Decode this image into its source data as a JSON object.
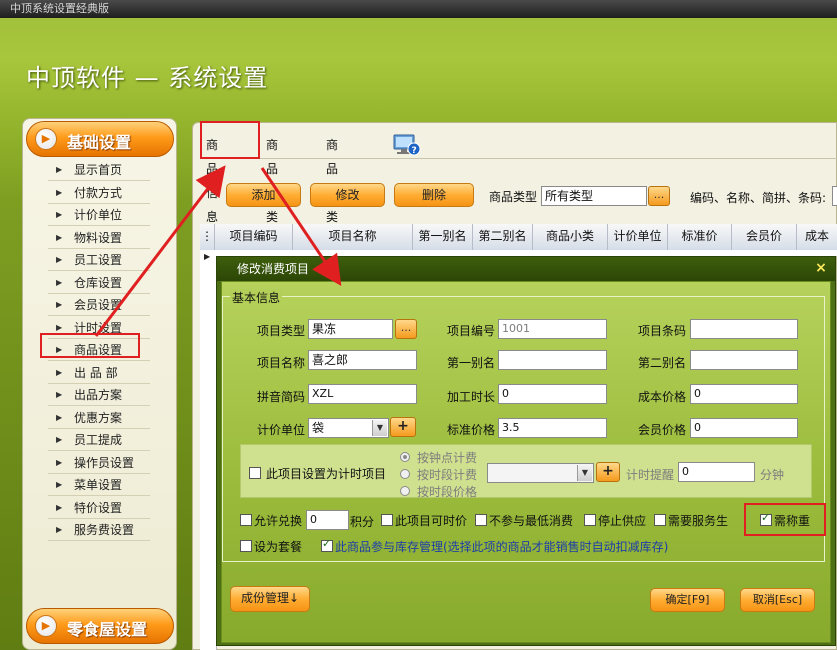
{
  "window": {
    "title": "中顶系统设置经典版"
  },
  "app_title": "中顶软件 — 系统设置",
  "sidebar": {
    "header": "基础设置",
    "footer": "零食屋设置",
    "items": [
      "显示首页",
      "付款方式",
      "计价单位",
      "物料设置",
      "员工设置",
      "仓库设置",
      "会员设置",
      "计时设置",
      "商品设置",
      "出 品 部",
      "出品方案",
      "优惠方案",
      "员工提成",
      "操作员设置",
      "菜单设置",
      "特价设置",
      "服务费设置"
    ],
    "active": "商品设置"
  },
  "tabs": [
    "商品信息",
    "商品大类",
    "商品小类"
  ],
  "toolbar": {
    "add": "添加",
    "edit": "修改",
    "delete": "删除",
    "type_label": "商品类型",
    "type_value": "所有类型",
    "ellipsis": "...",
    "search_label": "编码、名称、简拼、条码:"
  },
  "grid_columns": [
    "项目编码",
    "项目名称",
    "第一别名",
    "第二别名",
    "商品小类",
    "计价单位",
    "标准价",
    "会员价",
    "成本"
  ],
  "dialog": {
    "title": "修改消费项目",
    "close": "×",
    "group": "基本信息",
    "fields": {
      "item_type": {
        "label": "项目类型",
        "value": "果冻"
      },
      "item_no": {
        "label": "项目编号",
        "value": "1001"
      },
      "barcode": {
        "label": "项目条码",
        "value": ""
      },
      "item_name": {
        "label": "项目名称",
        "value": "喜之郎"
      },
      "alias1": {
        "label": "第一别名",
        "value": ""
      },
      "alias2": {
        "label": "第二别名",
        "value": ""
      },
      "pinyin": {
        "label": "拼音简码",
        "value": "XZL"
      },
      "process_time": {
        "label": "加工时长",
        "value": "0"
      },
      "cost_price": {
        "label": "成本价格",
        "value": "0"
      },
      "unit": {
        "label": "计价单位",
        "value": "袋"
      },
      "std_price": {
        "label": "标准价格",
        "value": "3.5"
      },
      "member_price": {
        "label": "会员价格",
        "value": "0"
      }
    },
    "timing": {
      "checkbox_label": "此项目设置为计时项目",
      "radio1": "按钟点计费",
      "radio2": "按时段计费",
      "radio3": "按时段价格",
      "reminder_label": "计时提醒",
      "reminder_value": "0",
      "minutes": "分钟",
      "plus": "+"
    },
    "options": {
      "allow_exchange": "允许兑换",
      "exchange_value": "0",
      "points": "积分",
      "time_price": "此项目可时价",
      "no_min": "不参与最低消费",
      "stop_supply": "停止供应",
      "need_service": "需要服务生",
      "need_weigh": "需称重",
      "set_meal": "设为套餐",
      "inventory": "此商品参与库存管理(选择此项的商品才能销售时自动扣减库存)"
    },
    "buttons": {
      "component": "成份管理↓",
      "ok": "确定[F9]",
      "cancel": "取消[Esc]"
    }
  },
  "colors": {
    "accent_orange": "#ff9a1a",
    "highlight_red": "#e02020",
    "dialog_green": "#4d7015"
  }
}
